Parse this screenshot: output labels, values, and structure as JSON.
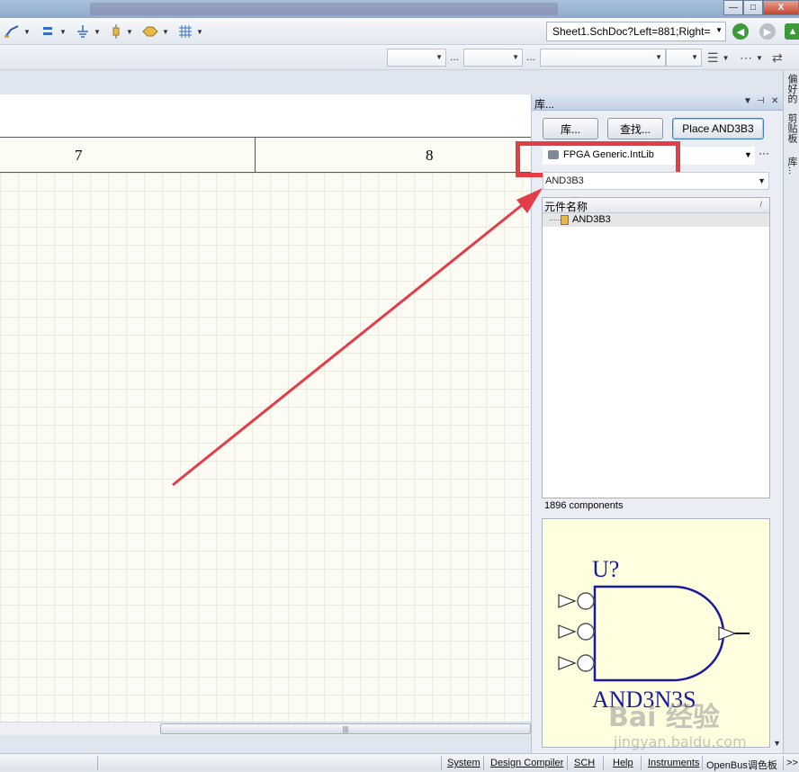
{
  "window": {
    "min_label": "—",
    "max_label": "□",
    "close_label": "X"
  },
  "toolbar": {
    "address": "Sheet1.SchDoc?Left=881;Right=",
    "separator_dots": [
      "...",
      "...",
      "..."
    ]
  },
  "ruler": {
    "col_left": "7",
    "col_right": "8"
  },
  "panel": {
    "title": "库...",
    "buttons": {
      "libraries": "库...",
      "search": "查找...",
      "place": "Place AND3B3"
    },
    "library_selected": "FPGA Generic.IntLib",
    "more_label": "···",
    "filter_value": "AND3B3",
    "list_header": "元件名称",
    "components": [
      "AND3B3"
    ],
    "count_text": "1896 components",
    "preview": {
      "designator": "U?",
      "part_name": "AND3N3S"
    }
  },
  "side_tabs": [
    "偏好的",
    "剪贴板",
    "库..."
  ],
  "statusbar": {
    "items": [
      "System",
      "Design Compiler",
      "SCH",
      "Help",
      "Instruments",
      "OpenBus调色板"
    ],
    "overflow": ">>"
  },
  "watermark": {
    "brand": "Bai 经验",
    "url": "jingyan.baidu.com"
  },
  "colors": {
    "highlight": "#e23e47",
    "gate": "#1a1aa0",
    "preview_bg": "#ffffe0",
    "sheet_bg": "#fdfcf4"
  }
}
